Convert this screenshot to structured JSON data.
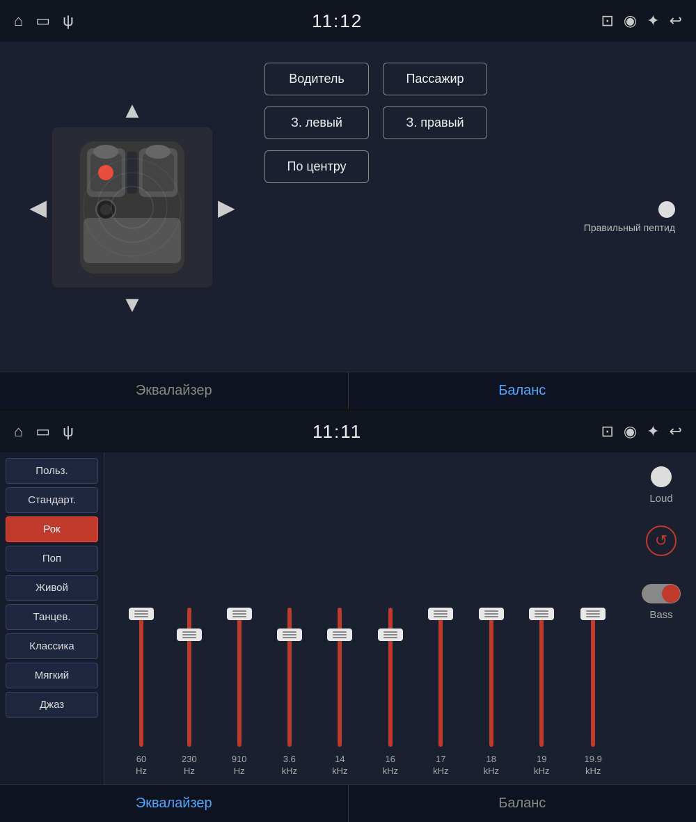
{
  "top_panel": {
    "status_bar": {
      "time": "11:12",
      "icons_left": [
        "home",
        "screen",
        "usb"
      ],
      "icons_right": [
        "cast",
        "location",
        "bluetooth",
        "back"
      ]
    },
    "seat_map": {
      "up_arrow": "▲",
      "down_arrow": "▼",
      "left_arrow": "◀",
      "right_arrow": "▶"
    },
    "buttons": {
      "driver": "Водитель",
      "passenger": "Пассажир",
      "rear_left": "З. левый",
      "rear_right": "З. правый",
      "center": "По центру",
      "indicator_label": "Правильный пептид"
    },
    "tabs": {
      "equalizer": "Эквалайзер",
      "balance": "Баланс"
    },
    "active_tab": "balance"
  },
  "bottom_panel": {
    "status_bar": {
      "time": "11:11"
    },
    "presets": [
      {
        "label": "Польз.",
        "active": false
      },
      {
        "label": "Стандарт.",
        "active": false
      },
      {
        "label": "Рок",
        "active": true
      },
      {
        "label": "Поп",
        "active": false
      },
      {
        "label": "Живой",
        "active": false
      },
      {
        "label": "Танцев.",
        "active": false
      },
      {
        "label": "Классика",
        "active": false
      },
      {
        "label": "Мягкий",
        "active": false
      },
      {
        "label": "Джаз",
        "active": false
      }
    ],
    "sliders": [
      {
        "freq": "60",
        "unit": "Hz",
        "position": 0
      },
      {
        "freq": "230",
        "unit": "Hz",
        "position": 30
      },
      {
        "freq": "910",
        "unit": "Hz",
        "position": 0
      },
      {
        "freq": "3.6",
        "unit": "kHz",
        "position": 30
      },
      {
        "freq": "14",
        "unit": "kHz",
        "position": 30
      },
      {
        "freq": "16",
        "unit": "kHz",
        "position": 30
      },
      {
        "freq": "17",
        "unit": "kHz",
        "position": 0
      },
      {
        "freq": "18",
        "unit": "kHz",
        "position": 0
      },
      {
        "freq": "19",
        "unit": "kHz",
        "position": 0
      },
      {
        "freq": "19.9",
        "unit": "kHz",
        "position": 0
      }
    ],
    "controls": {
      "loud_label": "Loud",
      "reset_icon": "↺",
      "bass_label": "Bass"
    },
    "tabs": {
      "equalizer": "Эквалайзер",
      "balance": "Баланс"
    },
    "active_tab": "equalizer"
  }
}
